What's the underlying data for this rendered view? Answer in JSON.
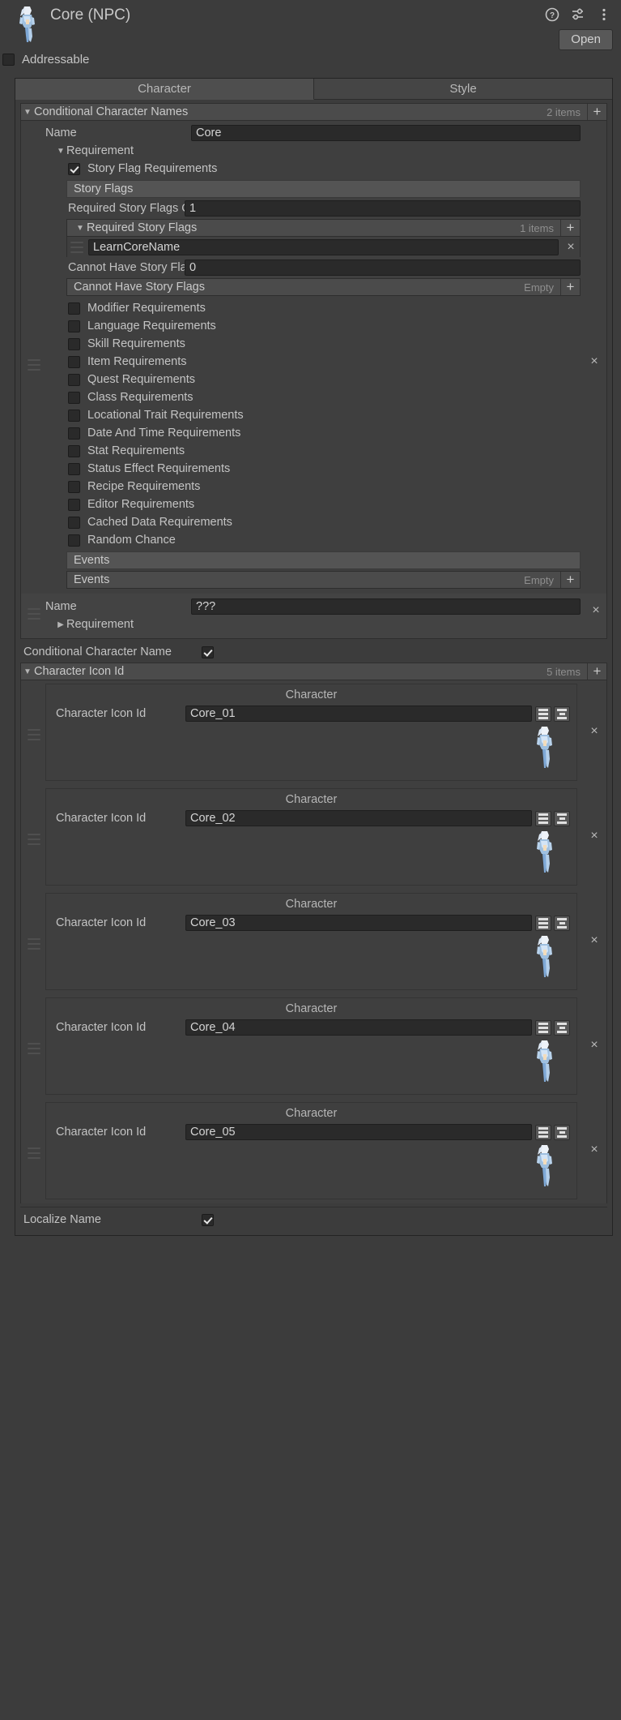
{
  "header": {
    "title": "Core (NPC)",
    "open_label": "Open",
    "icons": [
      "help-icon",
      "settings-sliders-icon",
      "kebab-menu-icon"
    ],
    "sprite": "character-sprite"
  },
  "addressable": {
    "label": "Addressable",
    "checked": false
  },
  "tabs": [
    {
      "label": "Character",
      "selected": true
    },
    {
      "label": "Style",
      "selected": false
    }
  ],
  "conditional_character_names": {
    "title": "Conditional Character Names",
    "count": "2 items",
    "add_label": "+",
    "entries": [
      {
        "name_label": "Name",
        "name_value": "Core",
        "requirement_label": "Requirement",
        "requirement_expanded": true,
        "story_flag_requirements": {
          "label": "Story Flag Requirements",
          "checked": true,
          "section_label": "Story Flags",
          "required_count_label": "Required Story Flags Count",
          "required_count_value": "1",
          "required_list_title": "Required Story Flags",
          "required_list_count": "1 items",
          "required_flags": [
            "LearnCoreName"
          ],
          "cannot_count_label": "Cannot Have Story Flags Count",
          "cannot_count_value": "0",
          "cannot_list_title": "Cannot Have Story Flags",
          "cannot_list_count": "Empty"
        },
        "requirement_toggles": [
          {
            "label": "Modifier Requirements",
            "checked": false
          },
          {
            "label": "Language Requirements",
            "checked": false
          },
          {
            "label": "Skill Requirements",
            "checked": false
          },
          {
            "label": "Item Requirements",
            "checked": false
          },
          {
            "label": "Quest Requirements",
            "checked": false
          },
          {
            "label": "Class Requirements",
            "checked": false
          },
          {
            "label": "Locational Trait Requirements",
            "checked": false
          },
          {
            "label": "Date And Time Requirements",
            "checked": false
          },
          {
            "label": "Stat Requirements",
            "checked": false
          },
          {
            "label": "Status Effect Requirements",
            "checked": false
          },
          {
            "label": "Recipe Requirements",
            "checked": false
          },
          {
            "label": "Editor Requirements",
            "checked": false
          },
          {
            "label": "Cached Data Requirements",
            "checked": false
          },
          {
            "label": "Random Chance",
            "checked": false
          }
        ],
        "events_section_label": "Events",
        "events_list_title": "Events",
        "events_list_count": "Empty",
        "remove_label": "×"
      },
      {
        "name_label": "Name",
        "name_value": "???",
        "requirement_label": "Requirement",
        "requirement_expanded": false,
        "remove_label": "×"
      }
    ]
  },
  "conditional_character_name": {
    "label": "Conditional Character Name",
    "checked": true
  },
  "character_icon_id": {
    "title": "Character Icon Id",
    "count": "5 items",
    "add_label": "+",
    "card_title": "Character",
    "row_label": "Character Icon Id",
    "remove_label": "×",
    "entries": [
      {
        "value": "Core_01"
      },
      {
        "value": "Core_02"
      },
      {
        "value": "Core_03"
      },
      {
        "value": "Core_04"
      },
      {
        "value": "Core_05"
      }
    ]
  },
  "localize_name": {
    "label": "Localize Name",
    "checked": true
  },
  "colors": {
    "window_bg": "#3c3c3c",
    "panel_bg": "#414141",
    "bar_bg": "#4b4b4b",
    "label_bar_bg": "#545454",
    "field_bg": "#2a2a2a",
    "text": "#c4c4c4",
    "muted_text": "#8e8e8e",
    "tab_selected": "#4e4e4e"
  }
}
